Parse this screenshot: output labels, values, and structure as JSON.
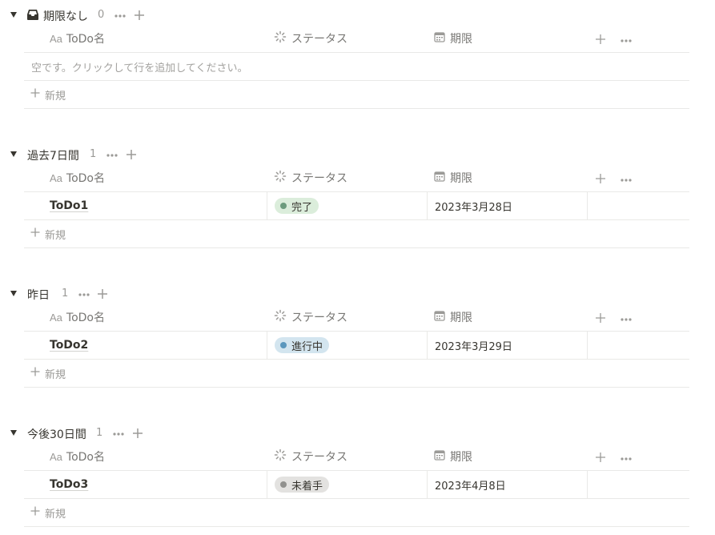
{
  "colors": {
    "done_bg": "#dbeddb",
    "done_dot": "#6c9b7d",
    "progress_bg": "#d3e5ef",
    "progress_dot": "#5b97bd",
    "notstarted_bg": "#e3e2e0",
    "notstarted_dot": "#91918e"
  },
  "columns": {
    "name": "ToDo名",
    "name_prefix": "Aa",
    "status": "ステータス",
    "date": "期限"
  },
  "new_label": "新規",
  "groups": [
    {
      "title": "期限なし",
      "count": "0",
      "empty_text": "空です。クリックして行を追加してください。",
      "rows": []
    },
    {
      "title": "過去7日間",
      "count": "1",
      "rows": [
        {
          "name": "ToDo1",
          "status": "完了",
          "status_kind": "done",
          "date": "2023年3月28日"
        }
      ]
    },
    {
      "title": "昨日",
      "count": "1",
      "rows": [
        {
          "name": "ToDo2",
          "status": "進行中",
          "status_kind": "progress",
          "date": "2023年3月29日"
        }
      ]
    },
    {
      "title": "今後30日間",
      "count": "1",
      "rows": [
        {
          "name": "ToDo3",
          "status": "未着手",
          "status_kind": "notstarted",
          "date": "2023年4月8日"
        }
      ]
    }
  ]
}
